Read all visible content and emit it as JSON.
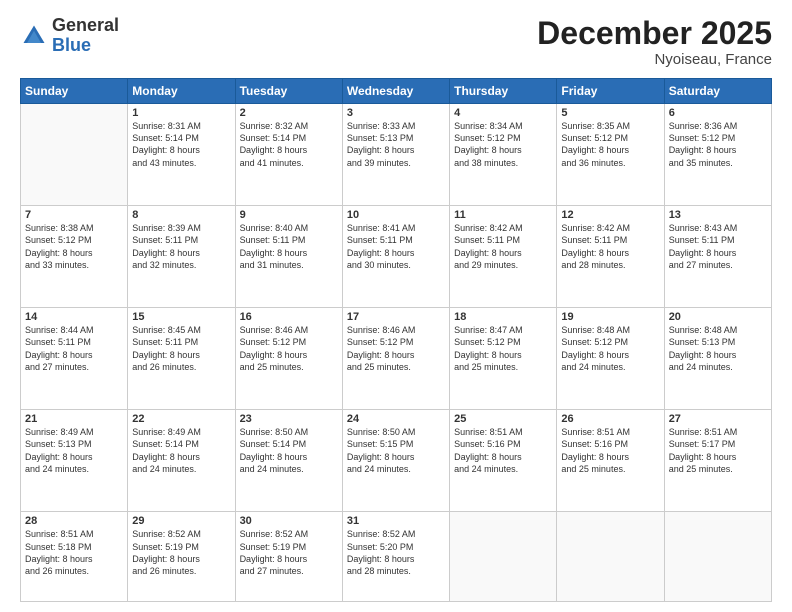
{
  "logo": {
    "general": "General",
    "blue": "Blue"
  },
  "header": {
    "month": "December 2025",
    "location": "Nyoiseau, France"
  },
  "weekdays": [
    "Sunday",
    "Monday",
    "Tuesday",
    "Wednesday",
    "Thursday",
    "Friday",
    "Saturday"
  ],
  "weeks": [
    [
      {
        "day": "",
        "content": ""
      },
      {
        "day": "1",
        "content": "Sunrise: 8:31 AM\nSunset: 5:14 PM\nDaylight: 8 hours\nand 43 minutes."
      },
      {
        "day": "2",
        "content": "Sunrise: 8:32 AM\nSunset: 5:14 PM\nDaylight: 8 hours\nand 41 minutes."
      },
      {
        "day": "3",
        "content": "Sunrise: 8:33 AM\nSunset: 5:13 PM\nDaylight: 8 hours\nand 39 minutes."
      },
      {
        "day": "4",
        "content": "Sunrise: 8:34 AM\nSunset: 5:12 PM\nDaylight: 8 hours\nand 38 minutes."
      },
      {
        "day": "5",
        "content": "Sunrise: 8:35 AM\nSunset: 5:12 PM\nDaylight: 8 hours\nand 36 minutes."
      },
      {
        "day": "6",
        "content": "Sunrise: 8:36 AM\nSunset: 5:12 PM\nDaylight: 8 hours\nand 35 minutes."
      }
    ],
    [
      {
        "day": "7",
        "content": "Sunrise: 8:38 AM\nSunset: 5:12 PM\nDaylight: 8 hours\nand 33 minutes."
      },
      {
        "day": "8",
        "content": "Sunrise: 8:39 AM\nSunset: 5:11 PM\nDaylight: 8 hours\nand 32 minutes."
      },
      {
        "day": "9",
        "content": "Sunrise: 8:40 AM\nSunset: 5:11 PM\nDaylight: 8 hours\nand 31 minutes."
      },
      {
        "day": "10",
        "content": "Sunrise: 8:41 AM\nSunset: 5:11 PM\nDaylight: 8 hours\nand 30 minutes."
      },
      {
        "day": "11",
        "content": "Sunrise: 8:42 AM\nSunset: 5:11 PM\nDaylight: 8 hours\nand 29 minutes."
      },
      {
        "day": "12",
        "content": "Sunrise: 8:42 AM\nSunset: 5:11 PM\nDaylight: 8 hours\nand 28 minutes."
      },
      {
        "day": "13",
        "content": "Sunrise: 8:43 AM\nSunset: 5:11 PM\nDaylight: 8 hours\nand 27 minutes."
      }
    ],
    [
      {
        "day": "14",
        "content": "Sunrise: 8:44 AM\nSunset: 5:11 PM\nDaylight: 8 hours\nand 27 minutes."
      },
      {
        "day": "15",
        "content": "Sunrise: 8:45 AM\nSunset: 5:11 PM\nDaylight: 8 hours\nand 26 minutes."
      },
      {
        "day": "16",
        "content": "Sunrise: 8:46 AM\nSunset: 5:12 PM\nDaylight: 8 hours\nand 25 minutes."
      },
      {
        "day": "17",
        "content": "Sunrise: 8:46 AM\nSunset: 5:12 PM\nDaylight: 8 hours\nand 25 minutes."
      },
      {
        "day": "18",
        "content": "Sunrise: 8:47 AM\nSunset: 5:12 PM\nDaylight: 8 hours\nand 25 minutes."
      },
      {
        "day": "19",
        "content": "Sunrise: 8:48 AM\nSunset: 5:12 PM\nDaylight: 8 hours\nand 24 minutes."
      },
      {
        "day": "20",
        "content": "Sunrise: 8:48 AM\nSunset: 5:13 PM\nDaylight: 8 hours\nand 24 minutes."
      }
    ],
    [
      {
        "day": "21",
        "content": "Sunrise: 8:49 AM\nSunset: 5:13 PM\nDaylight: 8 hours\nand 24 minutes."
      },
      {
        "day": "22",
        "content": "Sunrise: 8:49 AM\nSunset: 5:14 PM\nDaylight: 8 hours\nand 24 minutes."
      },
      {
        "day": "23",
        "content": "Sunrise: 8:50 AM\nSunset: 5:14 PM\nDaylight: 8 hours\nand 24 minutes."
      },
      {
        "day": "24",
        "content": "Sunrise: 8:50 AM\nSunset: 5:15 PM\nDaylight: 8 hours\nand 24 minutes."
      },
      {
        "day": "25",
        "content": "Sunrise: 8:51 AM\nSunset: 5:16 PM\nDaylight: 8 hours\nand 24 minutes."
      },
      {
        "day": "26",
        "content": "Sunrise: 8:51 AM\nSunset: 5:16 PM\nDaylight: 8 hours\nand 25 minutes."
      },
      {
        "day": "27",
        "content": "Sunrise: 8:51 AM\nSunset: 5:17 PM\nDaylight: 8 hours\nand 25 minutes."
      }
    ],
    [
      {
        "day": "28",
        "content": "Sunrise: 8:51 AM\nSunset: 5:18 PM\nDaylight: 8 hours\nand 26 minutes."
      },
      {
        "day": "29",
        "content": "Sunrise: 8:52 AM\nSunset: 5:19 PM\nDaylight: 8 hours\nand 26 minutes."
      },
      {
        "day": "30",
        "content": "Sunrise: 8:52 AM\nSunset: 5:19 PM\nDaylight: 8 hours\nand 27 minutes."
      },
      {
        "day": "31",
        "content": "Sunrise: 8:52 AM\nSunset: 5:20 PM\nDaylight: 8 hours\nand 28 minutes."
      },
      {
        "day": "",
        "content": ""
      },
      {
        "day": "",
        "content": ""
      },
      {
        "day": "",
        "content": ""
      }
    ]
  ]
}
